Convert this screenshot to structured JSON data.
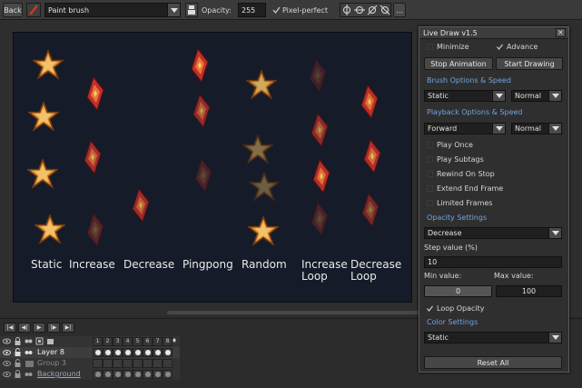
{
  "toolbar": {
    "back_label": "Back",
    "tool_name": "Paint brush",
    "opacity_label": "Opacity:",
    "opacity_value": "255",
    "pixel_perfect_label": "Pixel-perfect",
    "more_label": "..."
  },
  "canvas": {
    "background": "#151b28",
    "columns": [
      {
        "label": "Static"
      },
      {
        "label": "Increase"
      },
      {
        "label": "Decrease"
      },
      {
        "label": "Pingpong"
      },
      {
        "label": "Random"
      },
      {
        "label": "Increase\nLoop"
      },
      {
        "label": "Decrease\nLoop"
      }
    ]
  },
  "timeline": {
    "frame_numbers": [
      "1",
      "2",
      "3",
      "4",
      "5",
      "6",
      "7",
      "8"
    ],
    "layers": [
      {
        "name": "Layer 8"
      },
      {
        "name": "Group 3"
      },
      {
        "name": "Background"
      }
    ]
  },
  "panel": {
    "title": "Live Draw v1.5",
    "close_label": "×",
    "minimize_label": "Minimize",
    "advance_label": "Advance",
    "stop_animation_label": "Stop Animation",
    "start_drawing_label": "Start Drawing",
    "brush_section": "Brush Options & Speed",
    "brush_mode": "Static",
    "brush_speed": "Normal",
    "playback_section": "Playback Options & Speed",
    "playback_mode": "Forward",
    "playback_speed": "Normal",
    "play_once": "Play Once",
    "play_subtags": "Play Subtags",
    "rewind_on_stop": "Rewind On Stop",
    "extend_end_frame": "Extend End Frame",
    "limited_frames": "Limited Frames",
    "opacity_section": "Opacity Settings",
    "opacity_mode": "Decrease",
    "step_label": "Step value (%)",
    "step_value": "10",
    "min_label": "Min value:",
    "max_label": "Max value:",
    "min_value": "0",
    "max_value": "100",
    "loop_opacity": "Loop Opacity",
    "color_section": "Color Settings",
    "color_mode": "Static",
    "reset_label": "Reset All",
    "accent": "#6fa5e0"
  }
}
